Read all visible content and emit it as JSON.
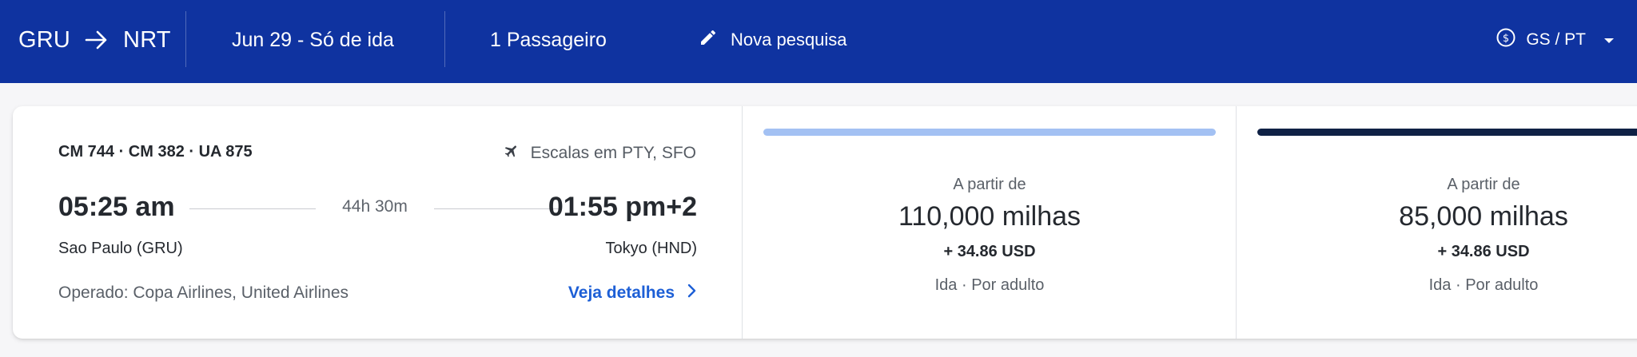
{
  "header": {
    "origin": "GRU",
    "destination": "NRT",
    "date_trip": "Jun 29 - Só de ida",
    "passengers": "1 Passageiro",
    "new_search": "Nova pesquisa",
    "locale": "GS / PT"
  },
  "flight": {
    "codes": "CM 744 · CM 382 · UA 875",
    "stops": "Escalas em PTY, SFO",
    "departure_time": "05:25 am",
    "arrival_time": "01:55 pm+2",
    "duration": "44h 30m",
    "departure_city": "Sao Paulo (GRU)",
    "arrival_city": "Tokyo (HND)",
    "operated_by": "Operado: Copa Airlines, United Airlines",
    "details_link": "Veja detalhes"
  },
  "fares": [
    {
      "from_label": "A partir de",
      "miles": "110,000 milhas",
      "fee": "+ 34.86 USD",
      "note": "Ida · Por adulto",
      "bar_color": "#a3c1f3"
    },
    {
      "from_label": "A partir de",
      "miles": "85,000 milhas",
      "fee": "+ 34.86 USD",
      "note": "Ida · Por adulto",
      "bar_color": "#0f2145"
    }
  ],
  "icons": {
    "arrow": "arrow-right-icon",
    "pencil": "pencil-icon",
    "currency": "dollar-circle-icon",
    "caret": "caret-down-icon",
    "plane": "airplane-icon",
    "chevron": "chevron-right-icon"
  }
}
